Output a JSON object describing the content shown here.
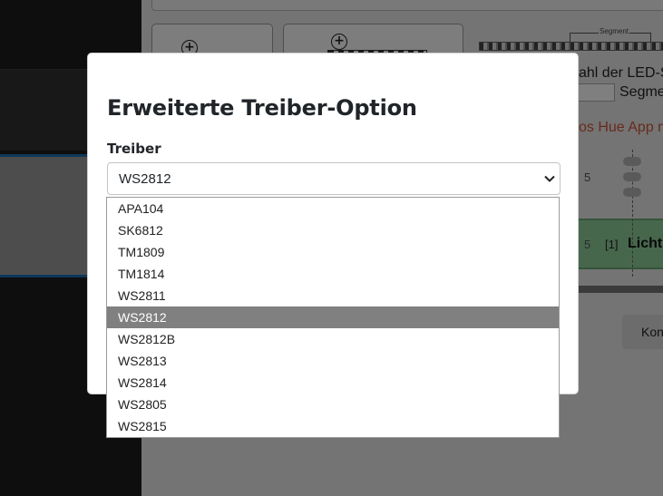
{
  "background": {
    "segment_label": "Segment",
    "text_led": "ahl der LED-S",
    "text_segment": "Segme",
    "text_app": "os Hue App m",
    "num_top": "5",
    "num_bottom": "5",
    "tag": "[1]",
    "licht": "Licht",
    "button": "Kon"
  },
  "modal": {
    "title": "Erweiterte Treiber-Option",
    "field_label": "Treiber",
    "selected_value": "WS2812"
  },
  "dropdown": {
    "options": [
      "APA104",
      "SK6812",
      "TM1809",
      "TM1814",
      "WS2811",
      "WS2812",
      "WS2812B",
      "WS2813",
      "WS2814",
      "WS2805",
      "WS2815"
    ],
    "highlighted": "WS2812"
  },
  "icons": {
    "select_arrow": "chevron-down-icon",
    "card_add": "plus-circle-icon"
  }
}
